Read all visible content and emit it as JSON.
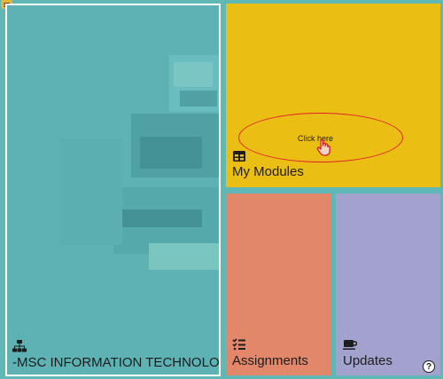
{
  "tiles": {
    "course": {
      "label": "-MSC INFORMATION TECHNOLOGY",
      "icon": "sitemap-icon"
    },
    "modules": {
      "label": "My Modules",
      "icon": "table-icon"
    },
    "assignments": {
      "label": "Assignments",
      "icon": "tasks-icon"
    },
    "updates": {
      "label": "Updates",
      "icon": "coffee-icon"
    }
  },
  "hint": {
    "text": "Click here",
    "icon": "pointing-hand-icon"
  },
  "help": {
    "label": "?",
    "icon": "help-icon"
  },
  "menu": {
    "icon": "hamburger-icon"
  },
  "colors": {
    "background": "#5fb7b6",
    "modules": "#ebbe14",
    "assignments": "#e3876a",
    "updates": "#a3a1cd",
    "hint_ring": "#e0202a"
  }
}
